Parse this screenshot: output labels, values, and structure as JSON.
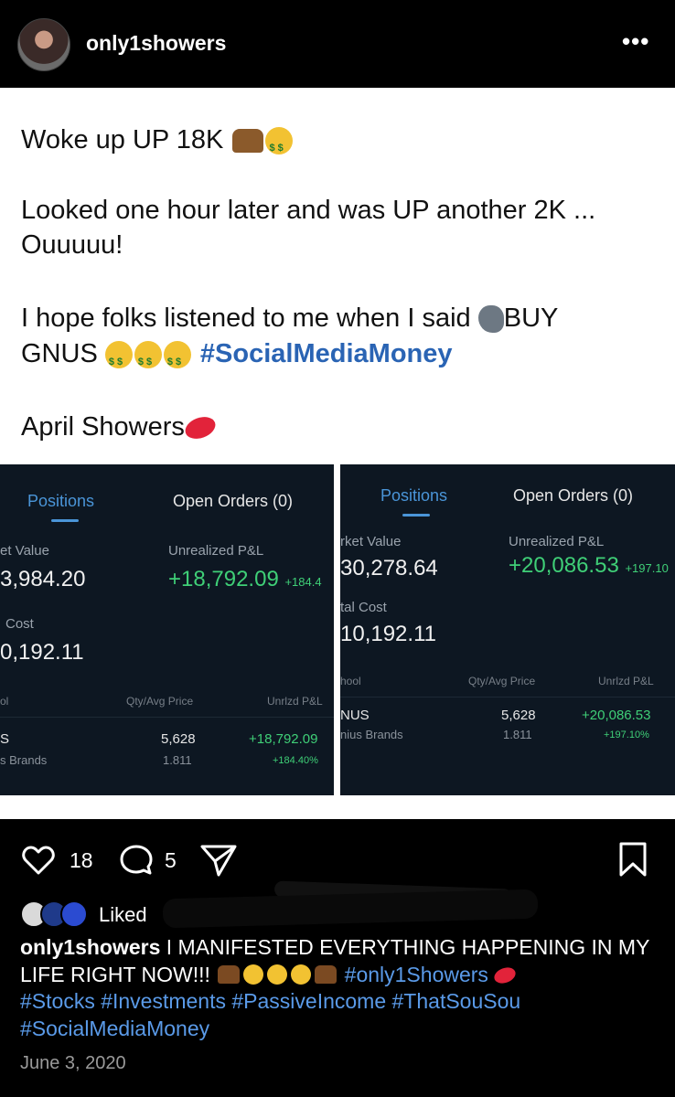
{
  "header": {
    "username": "only1showers",
    "more_icon": "more-horizontal-icon"
  },
  "post": {
    "line1": "Woke up UP 18K",
    "line2": "Looked one hour later and was UP another 2K ...",
    "line3": "Ouuuuu!",
    "line4": "I hope folks listened to me when I said",
    "line4_end": "BUY",
    "line5_start": "GNUS",
    "line5_hashtag": "#SocialMediaMoney",
    "line6": "April Showers"
  },
  "screens": [
    {
      "tab_positions": "Positions",
      "tab_orders": "Open Orders (0)",
      "market_value_label": "et Value",
      "market_value": "3,984.20",
      "unrealized_label": "Unrealized P&L",
      "unrealized_value": "+18,792.09",
      "unrealized_pct": "+184.4",
      "cost_label": "Cost",
      "cost_value": "0,192.11",
      "col_symbol": "ol",
      "col_qty": "Qty/Avg Price",
      "col_pl": "Unrlzd P&L",
      "row_symbol": "S",
      "row_name": "s Brands",
      "row_qty": "5,628",
      "row_avg": "1.811",
      "row_pl": "+18,792.09",
      "row_pl_pct": "+184.40%"
    },
    {
      "tab_positions": "Positions",
      "tab_orders": "Open Orders (0)",
      "market_value_label": "rket Value",
      "market_value": "30,278.64",
      "unrealized_label": "Unrealized P&L",
      "unrealized_value": "+20,086.53",
      "unrealized_pct": "+197.10",
      "cost_label": "tal Cost",
      "cost_value": "10,192.11",
      "col_symbol": "hool",
      "col_qty": "Qty/Avg Price",
      "col_pl": "Unrlzd P&L",
      "row_symbol": "NUS",
      "row_name": "nius Brands",
      "row_qty": "5,628",
      "row_avg": "1.811",
      "row_pl": "+20,086.53",
      "row_pl_pct": "+197.10%"
    }
  ],
  "actions": {
    "likes": "18",
    "comments": "5"
  },
  "liked_by": {
    "prefix": "Liked "
  },
  "caption": {
    "username": "only1showers",
    "text": "I MANIFESTED EVERYTHING HAPPENING IN MY LIFE RIGHT NOW!!!",
    "tag1": "#only1Showers",
    "tags_line": "#Stocks #Investments #PassiveIncome #ThatSouSou",
    "tag_last": "#SocialMediaMoney"
  },
  "date": "June 3, 2020",
  "colors": {
    "hashtag_in_image": "#2a64b4",
    "hashtag_caption": "#5a9ae8",
    "profit_green": "#3fcf77",
    "tab_blue": "#4a95d8"
  }
}
